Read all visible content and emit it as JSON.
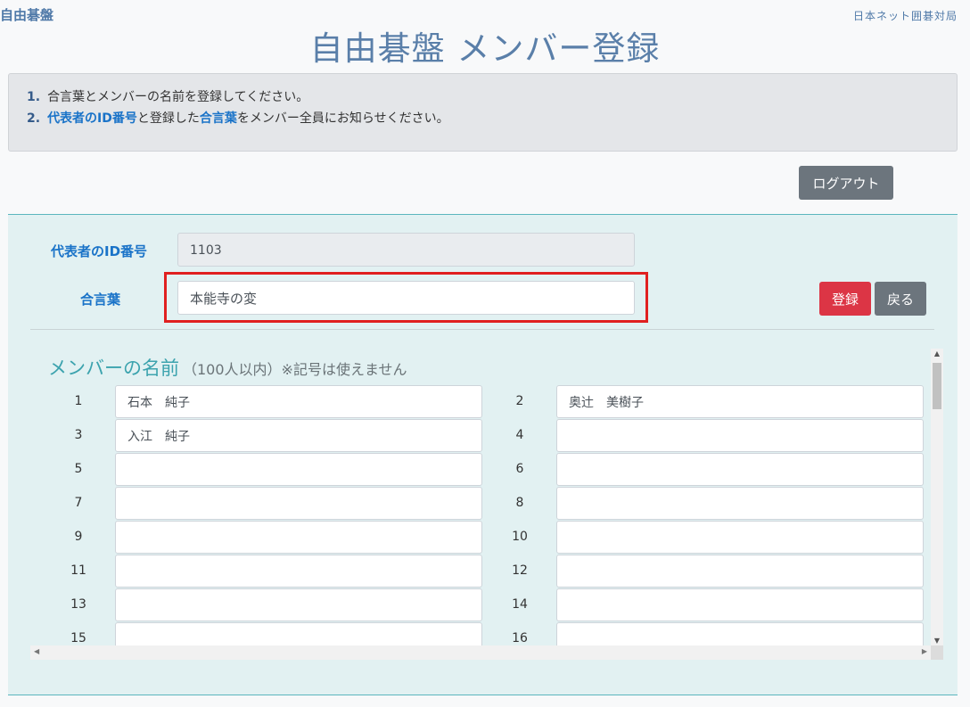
{
  "header": {
    "brand": "自由碁盤",
    "org": "日本ネット囲碁対局",
    "title": "自由碁盤 メンバー登録"
  },
  "info": {
    "line1": {
      "num": "1.",
      "text": "合言葉とメンバーの名前を登録してください。"
    },
    "line2": {
      "num": "2.",
      "hl1": "代表者のID番号",
      "mid": "と登録した",
      "hl2": "合言葉",
      "end": "をメンバー全員にお知らせください。"
    }
  },
  "buttons": {
    "logout": "ログアウト",
    "register": "登録",
    "back": "戻る"
  },
  "form": {
    "id_label": "代表者のID番号",
    "id_value": "1103",
    "password_label": "合言葉",
    "password_value": "本能寺の変"
  },
  "members": {
    "heading": "メンバーの名前",
    "subheading": "（100人以内）※記号は使えません",
    "rows": [
      {
        "left_num": "1",
        "left_name": "石本　純子",
        "right_num": "2",
        "right_name": "奥辻　美樹子"
      },
      {
        "left_num": "3",
        "left_name": "入江　純子",
        "right_num": "4",
        "right_name": ""
      },
      {
        "left_num": "5",
        "left_name": "",
        "right_num": "6",
        "right_name": ""
      },
      {
        "left_num": "7",
        "left_name": "",
        "right_num": "8",
        "right_name": ""
      },
      {
        "left_num": "9",
        "left_name": "",
        "right_num": "10",
        "right_name": ""
      },
      {
        "left_num": "11",
        "left_name": "",
        "right_num": "12",
        "right_name": ""
      },
      {
        "left_num": "13",
        "left_name": "",
        "right_num": "14",
        "right_name": ""
      },
      {
        "left_num": "15",
        "left_name": "",
        "right_num": "16",
        "right_name": ""
      }
    ]
  },
  "colors": {
    "accent_blue": "#1a73c8",
    "title_blue": "#5a7fa9",
    "register_red": "#dc3545",
    "button_gray": "#6c757d",
    "panel_bg": "#e2f1f2",
    "highlight_red": "#e02020"
  }
}
